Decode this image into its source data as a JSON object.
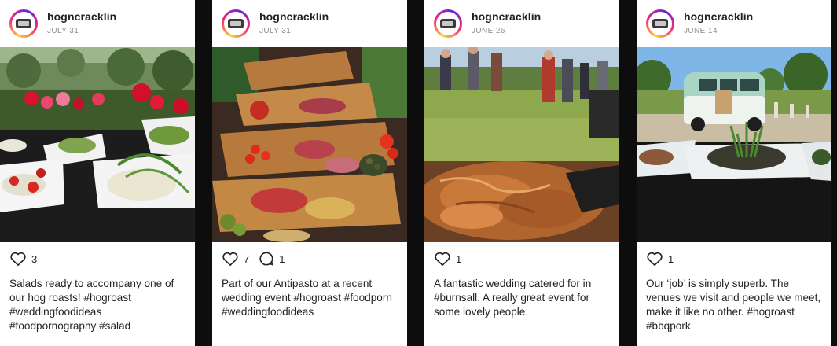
{
  "posts": [
    {
      "username": "hogncracklin",
      "date": "JULY 31",
      "likes": "3",
      "caption": "Salads ready to accompany one of our hog roasts! #hogroast #weddingfoodideas #foodpornography #salad",
      "image": "salad-buffet-garden-photo"
    },
    {
      "username": "hogncracklin",
      "date": "JULY 31",
      "likes": "7",
      "comments": "1",
      "caption": "Part of our Antipasto at a recent wedding event #hogroast #foodporn #weddingfoodideas",
      "image": "antipasto-platter-photo"
    },
    {
      "username": "hogncracklin",
      "date": "JUNE 26",
      "likes": "1",
      "caption": "A fantastic wedding catered for in #burnsall. A really great event for some lovely people.",
      "image": "pulled-pork-wedding-photo"
    },
    {
      "username": "hogncracklin",
      "date": "JUNE 14",
      "likes": "1",
      "caption": "Our ‘job’ is simply superb. The venues we visit and people we meet, make it like no other. #hogroast #bbqpork",
      "image": "campervan-salad-photo"
    }
  ],
  "icons": {
    "like": "heart-icon",
    "comment": "comment-bubble-icon",
    "avatar": "hogncracklin-logo"
  },
  "colors": {
    "avatar_ring_start": "#f9ce34",
    "avatar_ring_mid": "#ee2a7b",
    "avatar_ring_end": "#6228d7",
    "text": "#222222",
    "date": "#8e8e8e",
    "background": "#0d0d0d"
  }
}
